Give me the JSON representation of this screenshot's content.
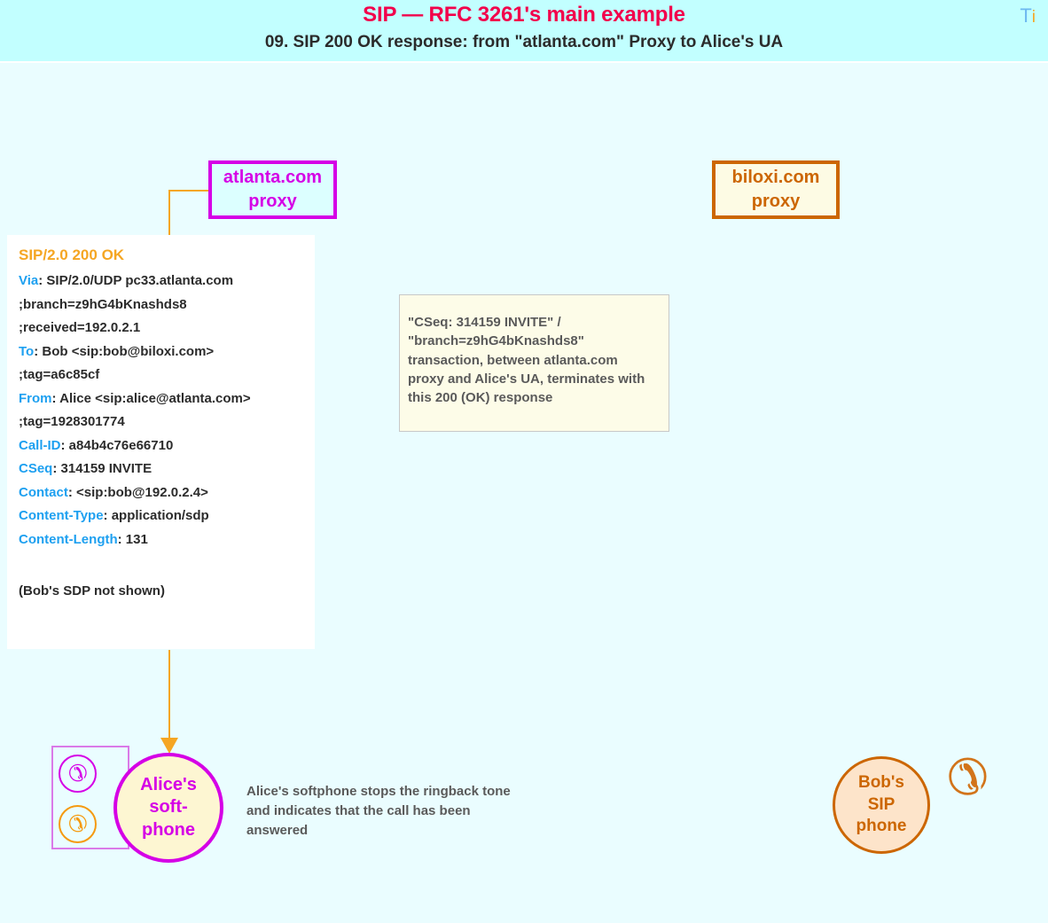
{
  "header": {
    "title": "SIP — RFC 3261's main example",
    "subtitle": "09.  SIP 200 OK response: from \"atlanta.com\" Proxy to Alice's UA",
    "logo_t": "T",
    "logo_i": "i",
    "title_color": "#f2004b",
    "background_color": "#c2ffff"
  },
  "nodes": {
    "atlanta_proxy": {
      "line1": "atlanta.com",
      "line2": "proxy",
      "border_color": "#d500e6",
      "fill_color": "#dcffff"
    },
    "biloxi_proxy": {
      "line1": "biloxi.com",
      "line2": "proxy",
      "border_color": "#cc6600",
      "fill_color": "#fdfbe4"
    },
    "alice_phone": {
      "line1": "Alice's",
      "line2": "soft-",
      "line3": "phone",
      "border_color": "#d500e6",
      "fill_color": "#fdf6d2"
    },
    "bob_phone": {
      "line1": "Bob's",
      "line2": "SIP",
      "line3": "phone",
      "border_color": "#cc6600",
      "fill_color": "#fde4ca"
    }
  },
  "sip_message": {
    "start_line": "SIP/2.0 200 OK",
    "start_line_color": "#f5a623",
    "header_color": "#1ea0f0",
    "lines": [
      {
        "header": "Via",
        "sep": ": ",
        "value": "SIP/2.0/UDP pc33.atlanta.com"
      },
      {
        "header": "",
        "sep": "",
        "value": " ;branch=z9hG4bKnashds8"
      },
      {
        "header": "",
        "sep": "",
        "value": " ;received=192.0.2.1"
      },
      {
        "header": "To",
        "sep": ": ",
        "value": "Bob <sip:bob@biloxi.com>"
      },
      {
        "header": "",
        "sep": "",
        "value": " ;tag=a6c85cf"
      },
      {
        "header": "From",
        "sep": ": ",
        "value": "Alice <sip:alice@atlanta.com>"
      },
      {
        "header": "",
        "sep": "",
        "value": " ;tag=1928301774"
      },
      {
        "header": "Call-ID",
        "sep": ": ",
        "value": "a84b4c76e66710"
      },
      {
        "header": "CSeq",
        "sep": ": ",
        "value": "314159 INVITE"
      },
      {
        "header": "Contact",
        "sep": ": ",
        "value": "<sip:bob@192.0.2.4>"
      },
      {
        "header": "Content-Type",
        "sep": ": ",
        "value": "application/sdp"
      },
      {
        "header": "Content-Length",
        "sep": ": ",
        "value": "131"
      },
      {
        "header": "",
        "sep": "",
        "value": ""
      },
      {
        "header": "",
        "sep": "",
        "value": "(Bob's SDP not shown)"
      }
    ]
  },
  "notes": {
    "transaction": "\"CSeq: 314159 INVITE\" / \"branch=z9hG4bKnashds8\" transaction, between atlanta.com proxy and Alice's UA, terminates with this 200 (OK) response",
    "alice": "Alice's softphone stops the ringback tone and indicates that the call has been answered"
  },
  "icons": {
    "handset": "☎",
    "handset_alt": "✆"
  },
  "colors": {
    "page_background": "#eafdff",
    "arrow": "#f5a623",
    "note_fill": "#fdfce8",
    "note_border": "#c8c8c8",
    "body_text": "#2b2b2b",
    "note_text": "#5a5a5a"
  }
}
